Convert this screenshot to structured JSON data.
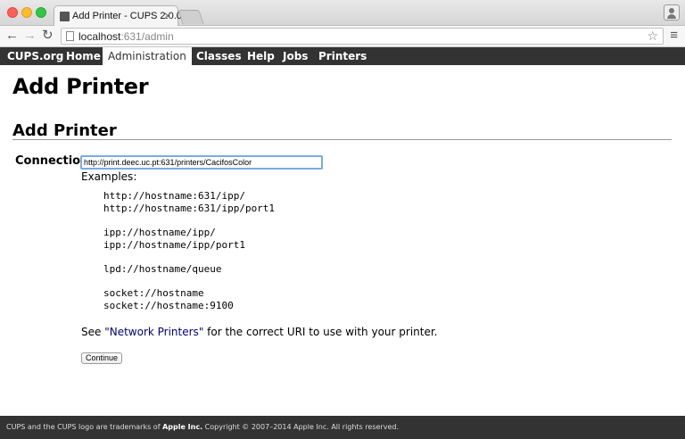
{
  "browser": {
    "tab_title": "Add Printer - CUPS 2.0.0",
    "url_host": "localhost",
    "url_path": ":631/admin"
  },
  "nav": {
    "items": [
      {
        "label": "CUPS.org"
      },
      {
        "label": "Home"
      },
      {
        "label": "Administration",
        "active": true
      },
      {
        "label": "Classes"
      },
      {
        "label": "Help"
      },
      {
        "label": "Jobs"
      },
      {
        "label": "Printers"
      }
    ]
  },
  "page": {
    "title": "Add Printer",
    "section_title": "Add Printer",
    "connection_label": "Connection:",
    "connection_value": "http://print.deec.uc.pt:631/printers/CacifosColor",
    "examples_label": "Examples:",
    "examples": {
      "ipp": [
        "http://hostname:631/ipp/",
        "http://hostname:631/ipp/port1"
      ],
      "ipp2": [
        "ipp://hostname/ipp/",
        "ipp://hostname/ipp/port1"
      ],
      "lpd": [
        "lpd://hostname/queue"
      ],
      "socket": [
        "socket://hostname",
        "socket://hostname:9100"
      ]
    },
    "see_prefix": "See ",
    "see_link": "\"Network Printers\"",
    "see_suffix": " for the correct URI to use with your printer.",
    "continue_label": "Continue"
  },
  "footer": {
    "prefix": "CUPS and the CUPS logo are trademarks of ",
    "company": "Apple Inc.",
    "suffix": " Copyright © 2007–2014 Apple Inc. All rights reserved."
  },
  "colors": {
    "nav_bg": "#333333",
    "link": "#000080",
    "input_focus": "#7aacdf"
  }
}
